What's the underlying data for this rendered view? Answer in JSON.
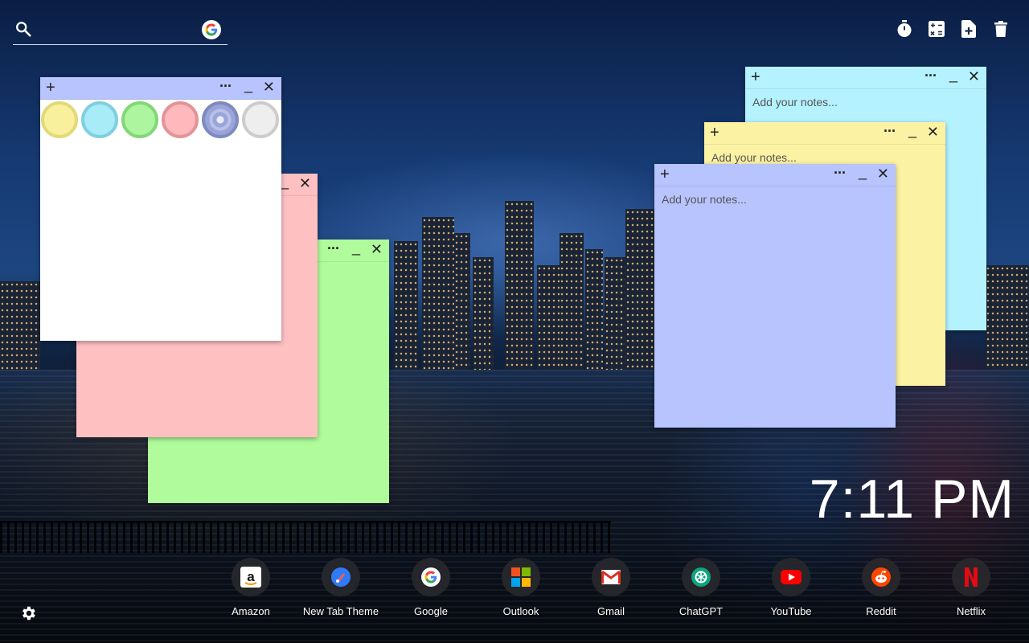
{
  "search": {
    "placeholder": "",
    "engine_icon": "google-icon"
  },
  "toolbar": {
    "items": [
      {
        "name": "timer-icon"
      },
      {
        "name": "calculator-icon"
      },
      {
        "name": "new-note-icon"
      },
      {
        "name": "trash-icon"
      }
    ]
  },
  "notes": {
    "placeholder": "Add your notes...",
    "add_symbol": "+",
    "more_symbol": "···",
    "min_symbol": "_",
    "close_symbol": "✕",
    "colors": {
      "white": "#ffffff",
      "pink": "#ffc0c2",
      "green": "#b0fc9c",
      "cyan": "#b4f2ff",
      "yellow": "#fcf2a4",
      "blue": "#b7c4fd"
    },
    "palette": [
      {
        "name": "yellow",
        "fill": "#f8f09c",
        "ring": "#e2d97a"
      },
      {
        "name": "cyan",
        "fill": "#a8ecf8",
        "ring": "#7fcfe0"
      },
      {
        "name": "green",
        "fill": "#aef5a0",
        "ring": "#84d67a"
      },
      {
        "name": "pink",
        "fill": "#ffb8bb",
        "ring": "#e29498"
      },
      {
        "name": "blue",
        "fill": "#9aa4d6",
        "ring": "#7f8ac0",
        "selected": true
      },
      {
        "name": "white",
        "fill": "#eeeeee",
        "ring": "#cccccc"
      }
    ]
  },
  "clock": {
    "time": "7:11 PM"
  },
  "dock": {
    "apps": [
      {
        "label": "Amazon",
        "icon": "amazon-icon"
      },
      {
        "label": "New Tab Theme",
        "icon": "new-tab-theme-icon"
      },
      {
        "label": "Google",
        "icon": "google-icon"
      },
      {
        "label": "Outlook",
        "icon": "outlook-icon"
      },
      {
        "label": "Gmail",
        "icon": "gmail-icon"
      },
      {
        "label": "ChatGPT",
        "icon": "chatgpt-icon"
      },
      {
        "label": "YouTube",
        "icon": "youtube-icon"
      },
      {
        "label": "Reddit",
        "icon": "reddit-icon"
      },
      {
        "label": "Netflix",
        "icon": "netflix-icon"
      }
    ]
  },
  "settings": {
    "icon": "gear-icon"
  }
}
